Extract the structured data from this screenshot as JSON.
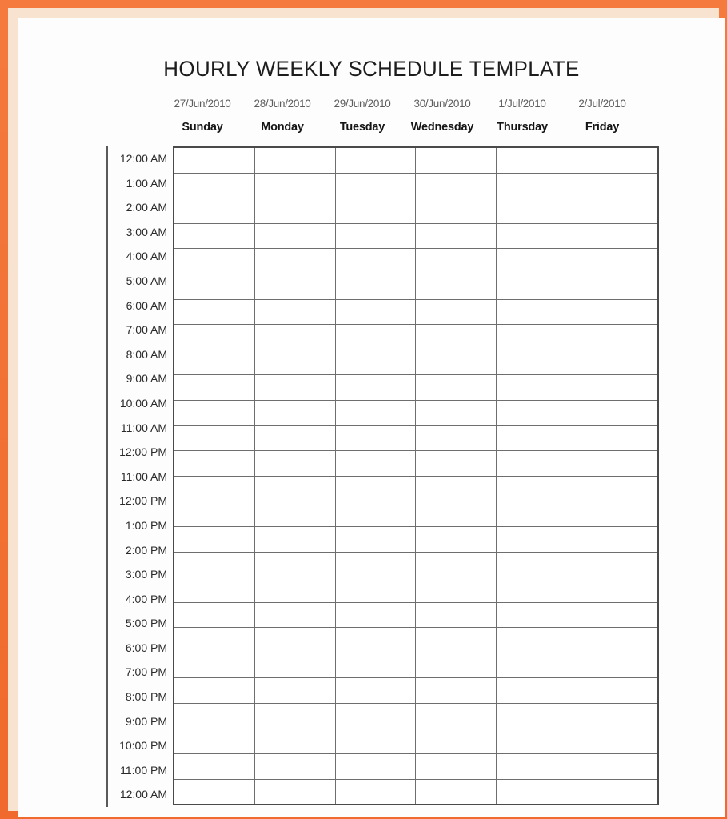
{
  "document": {
    "title": "HOURLY WEEKLY SCHEDULE TEMPLATE"
  },
  "theme": {
    "frame_color": "#f26b31",
    "frame_inner_color": "#f7e3cf",
    "page_background": "#fdfdfd",
    "grid_line_color": "#6e6e6e",
    "grid_border_color": "#4a4a4a",
    "date_text_color": "#5d5d5d",
    "day_text_color": "#151515"
  },
  "table": {
    "dates": [
      "27/Jun/2010",
      "28/Jun/2010",
      "29/Jun/2010",
      "30/Jun/2010",
      "1/Jul/2010",
      "2/Jul/2010"
    ],
    "days": [
      "Sunday",
      "Monday",
      "Tuesday",
      "Wednesday",
      "Thursday",
      "Friday"
    ],
    "times": [
      "12:00 AM",
      "1:00 AM",
      "2:00 AM",
      "3:00 AM",
      "4:00 AM",
      "5:00 AM",
      "6:00 AM",
      "7:00 AM",
      "8:00 AM",
      "9:00 AM",
      "10:00 AM",
      "11:00 AM",
      "12:00 PM",
      "11:00 AM",
      "12:00 PM",
      "1:00 PM",
      "2:00 PM",
      "3:00 PM",
      "4:00 PM",
      "5:00 PM",
      "6:00 PM",
      "7:00 PM",
      "8:00 PM",
      "9:00 PM",
      "10:00 PM",
      "11:00 PM",
      "12:00 AM"
    ],
    "cells": [
      [
        "",
        "",
        "",
        "",
        "",
        ""
      ],
      [
        "",
        "",
        "",
        "",
        "",
        ""
      ],
      [
        "",
        "",
        "",
        "",
        "",
        ""
      ],
      [
        "",
        "",
        "",
        "",
        "",
        ""
      ],
      [
        "",
        "",
        "",
        "",
        "",
        ""
      ],
      [
        "",
        "",
        "",
        "",
        "",
        ""
      ],
      [
        "",
        "",
        "",
        "",
        "",
        ""
      ],
      [
        "",
        "",
        "",
        "",
        "",
        ""
      ],
      [
        "",
        "",
        "",
        "",
        "",
        ""
      ],
      [
        "",
        "",
        "",
        "",
        "",
        ""
      ],
      [
        "",
        "",
        "",
        "",
        "",
        ""
      ],
      [
        "",
        "",
        "",
        "",
        "",
        ""
      ],
      [
        "",
        "",
        "",
        "",
        "",
        ""
      ],
      [
        "",
        "",
        "",
        "",
        "",
        ""
      ],
      [
        "",
        "",
        "",
        "",
        "",
        ""
      ],
      [
        "",
        "",
        "",
        "",
        "",
        ""
      ],
      [
        "",
        "",
        "",
        "",
        "",
        ""
      ],
      [
        "",
        "",
        "",
        "",
        "",
        ""
      ],
      [
        "",
        "",
        "",
        "",
        "",
        ""
      ],
      [
        "",
        "",
        "",
        "",
        "",
        ""
      ],
      [
        "",
        "",
        "",
        "",
        "",
        ""
      ],
      [
        "",
        "",
        "",
        "",
        "",
        ""
      ],
      [
        "",
        "",
        "",
        "",
        "",
        ""
      ],
      [
        "",
        "",
        "",
        "",
        "",
        ""
      ],
      [
        "",
        "",
        "",
        "",
        "",
        ""
      ],
      [
        "",
        "",
        "",
        "",
        "",
        ""
      ]
    ]
  }
}
